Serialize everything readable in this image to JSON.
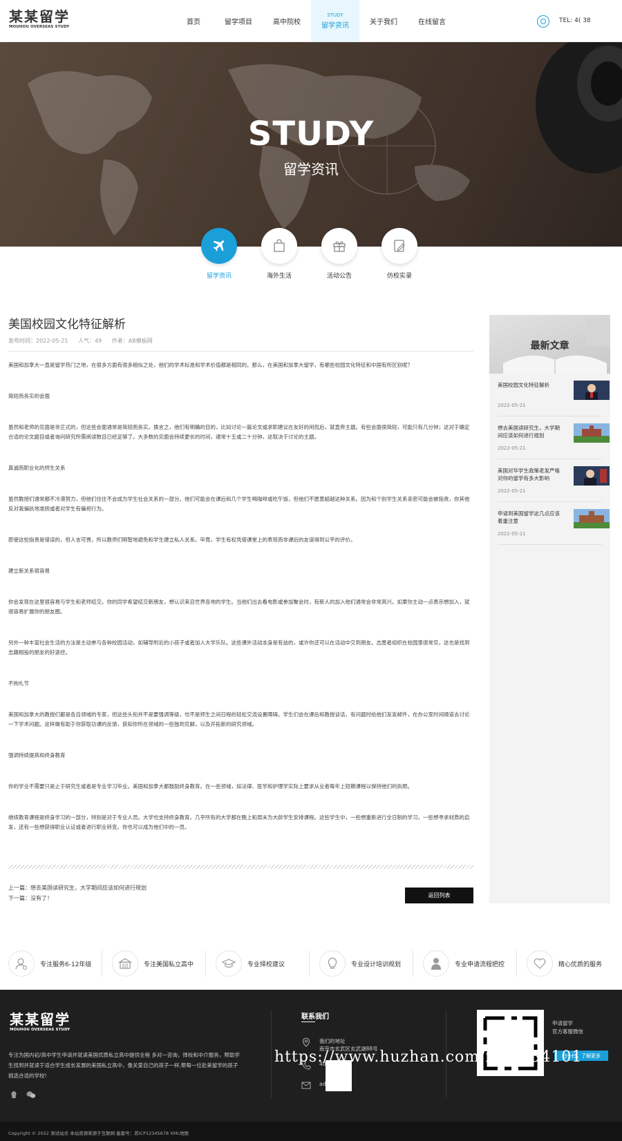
{
  "header": {
    "logo_cn": "某某留学",
    "logo_en": "MOUHOU OVERSEAS STUDY",
    "nav": [
      {
        "label": "首页",
        "sub": ""
      },
      {
        "label": "留学项目",
        "sub": ""
      },
      {
        "label": "高中院校",
        "sub": ""
      },
      {
        "label": "留学资讯",
        "sub": "STUDY",
        "active": true
      },
      {
        "label": "关于我们",
        "sub": ""
      },
      {
        "label": "在线留言",
        "sub": ""
      }
    ],
    "tel": "TEL: 4(              38"
  },
  "banner": {
    "title": "STUDY",
    "subtitle": "留学资讯"
  },
  "categories": [
    {
      "label": "留学资讯",
      "icon": "airplane-icon",
      "active": true
    },
    {
      "label": "海外生活",
      "icon": "shopping-bag-icon"
    },
    {
      "label": "活动公告",
      "icon": "gift-icon"
    },
    {
      "label": "仿校实录",
      "icon": "edit-icon"
    }
  ],
  "article": {
    "title": "美国校园文化特征解析",
    "meta_time": "发布时间：2022-05-21",
    "meta_views": "人气：49",
    "meta_author": "作者：AB模板网",
    "paragraphs": [
      "美国和加拿大一直是留学热门之地，在很多方面有很多相似之处，他们的学术标准和学术价值都是相同的。那么，在美国和加拿大留学，有哪些校园文化特征和中国有所区别呢？",
      "简短而务实的会面",
      "虽然和老师的见面是非正式的，但这些会面通常是简短而务实。换言之，他们有明确的目的，比如讨论一篇论文或求职建议在友好的闲侃后，就直奔主题。有些会面很简短，可能只有几分钟；这对于确定合适的论文题目或者询问研究所需阅读数目已经足够了。大多数的见面会持续更长的时间，通常十五或二十分钟，这取决于讨论的主题。",
      "真诚而职业化的师生关系",
      "虽然教授们通常都不冷漠努力，但他们往往不会成为学生社会关系的一部分。他们可能会在课后和几个学生喝咖啡或吃午饭，但他们不愿意超越这种关系。因为和个别学生关系亲密可能会被指责，你其他反对我偏执地准则或者对学生有偏袒行为。",
      "即使这些指责是错误的，但人言可畏，所以教师们明智地避免和学生建立私人关系。毕竟，学生有权凭借课堂上的表现而非课后的友谊得到公平的评价。",
      "建立新关系很容易",
      "你会发现在这里很容易与学生和老师结交。你的同学希望结交新朋友，想认识来自世界各地的学生。当他们出去看电影或参加聚会时，有新人的加入他们通常会非常高兴。如果你主动一点表示想加入，就很容易扩展你的朋友圈。",
      "另外一种丰富社会生活的方法是主动参与各种校园活动，如辅导附近的小孩子或者加入大学乐队。这些课外活动本身是有益的，或许你还可以在活动中交到朋友。志愿者组织在校园里很常见，这也是找到志趣相投的朋友的好途径。",
      "不拘礼节",
      "美国和加拿大的教授们都是各自领域的专家，但这些头衔并不是要强调等级，也不是师生之间日程的轻松交流设置障碍。学生们会在课后和教授谈话，有问题时给他们发发邮件，在办公室时间顺道去讨论一下学术问题。这样做有助于你获取功课的反馈，获知你所在领域的一些独到见解，以及开拓新的研究领域。",
      "强调持续提高和终身教育",
      "你的学业不需要只是止于研究生或者是专业学习毕业。美国和加拿大都鼓励终身教育。在一些领域，如法律、医学和护理学实际上要求从业者每年上短期课程以保持他们的执照。",
      "继续教育课程是终身学习的一部分，特别是对于专业人员。大学也支持终身教育。几乎所有的大学都在晚上和周末为大龄学生安排课程。这些学生中，一些想重新进行全日制的学习，一些想寻求材质的启发，还有一些想获得职业认证或者进行职业转变。你也可以成为他们中的一员。"
    ],
    "prev": "上一篇：想去美国读研究生，大学期间应该如何进行规划",
    "next": "下一篇：没有了！",
    "back_label": "返回列表"
  },
  "sidebar": {
    "title": "最新文章",
    "items": [
      {
        "title": "美国校园文化特征解析",
        "date": "2022-05-21"
      },
      {
        "title": "想去美国读研究生，大学期间应该如何进行规划",
        "date": "2022-05-21"
      },
      {
        "title": "美国对华学生政策老发严格对你的留学有多大影响",
        "date": "2022-05-21"
      },
      {
        "title": "申请到美国留学这几点应该着重注意",
        "date": "2022-05-21"
      }
    ]
  },
  "features": [
    {
      "label": "专注服务6-12年级",
      "icon": "user-service-icon"
    },
    {
      "label": "专注美国私立高中",
      "icon": "school-building-icon"
    },
    {
      "label": "专业择校建议",
      "icon": "graduation-cap-icon"
    },
    {
      "label": "专业设计培训规划",
      "icon": "lightbulb-icon"
    },
    {
      "label": "专业申请流程把控",
      "icon": "person-icon"
    },
    {
      "label": "精心优质的服务",
      "icon": "heart-icon"
    }
  ],
  "footer": {
    "logo_cn": "某某留学",
    "logo_en": "MOUHOU OVERSEAS STUDY",
    "desc": "专注为国内初/高中学生申请并就读美国优质私立高中提供全程 多对一咨询，择校和中介服务，帮助学生找到并就读于适合学生成长发展的美国私立高中，像关爱自己的孩子一样,帮每一位赴美留学的孩子挑选合适的学校!",
    "contact_title": "联系我们",
    "address_label": "我们的地址",
    "address": "南京市玄武区玄武湖88号",
    "phone": "40          3",
    "email": "ad             n.com",
    "qr_note_1": "申请留学",
    "qr_note_2": "官方客服微信",
    "qr_tag": "扫一扫，了解更多"
  },
  "copyright": "Copyright © 2022 测试站点 本站资源来源于互联网 备案号：苏ICP12345678 XML地图",
  "watermark": "https://www.huzhan.com/ishop34101",
  "colors": {
    "accent": "#1a9fd9",
    "footer_bg": "#1f1f1f"
  }
}
